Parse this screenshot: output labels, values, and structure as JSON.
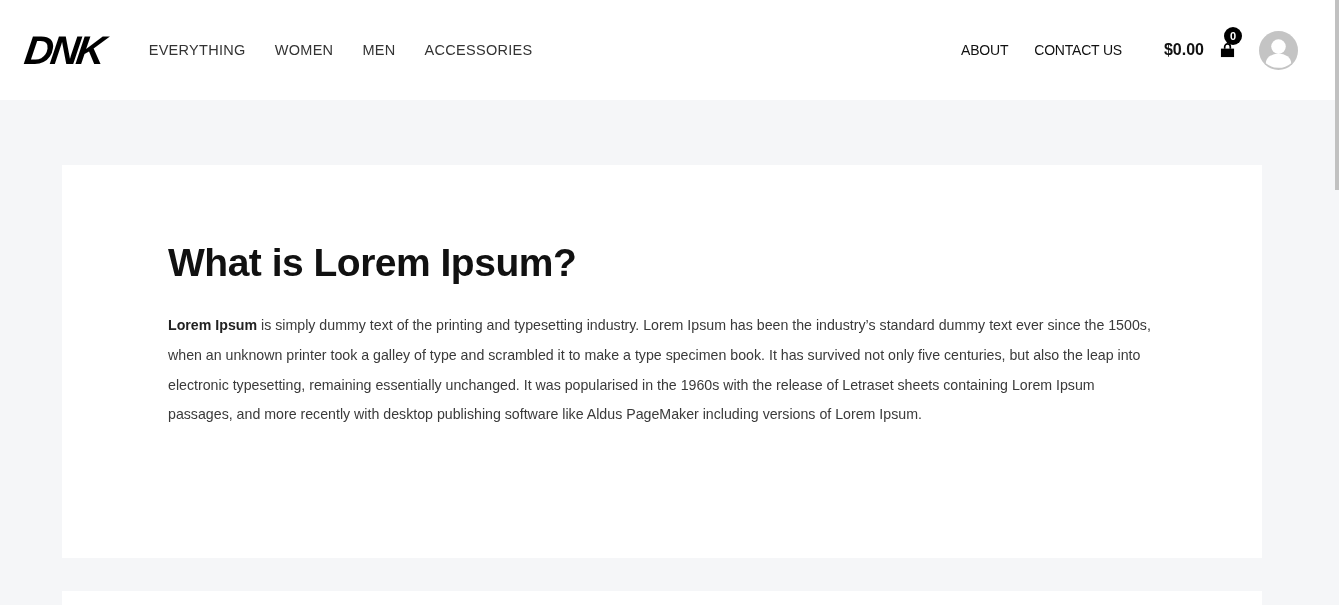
{
  "header": {
    "logo": "DNK",
    "nav_left": [
      {
        "label": "EVERYTHING"
      },
      {
        "label": "WOMEN"
      },
      {
        "label": "MEN"
      },
      {
        "label": "ACCESSORIES"
      }
    ],
    "nav_right": [
      {
        "label": "ABOUT"
      },
      {
        "label": "CONTACT US"
      }
    ],
    "cart": {
      "total": "$0.00",
      "count": "0"
    }
  },
  "article": {
    "title": "What is Lorem Ipsum?",
    "body": "**Lorem Ipsum** is simply dummy text of the printing and typesetting industry. Lorem Ipsum has been the industry’s standard dummy text ever since the 1500s, when an unknown printer took a galley of type and scrambled it to make a type specimen book. It has survived not only five centuries, but also the leap into electronic typesetting, remaining essentially unchanged. It was popularised in the 1960s with the release of Letraset sheets containing Lorem Ipsum passages, and more recently with desktop publishing software like Aldus PageMaker including versions of Lorem Ipsum."
  }
}
